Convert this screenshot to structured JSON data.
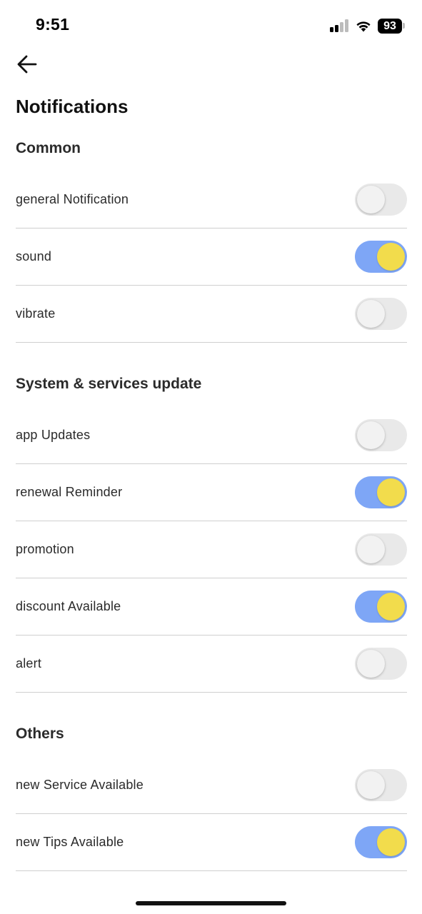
{
  "status_bar": {
    "time": "9:51",
    "battery_level": "93",
    "icons": [
      "signal-icon",
      "wifi-icon",
      "battery-icon"
    ]
  },
  "header": {
    "back_icon": "arrow-left-icon",
    "title": "Notifications"
  },
  "colors": {
    "toggle_on_track": "#7ea6f6",
    "toggle_on_knob": "#f2dc4c",
    "toggle_off_track": "#e9e9e9",
    "toggle_off_knob": "#f2f2f2",
    "divider": "#cfcfcf"
  },
  "sections": [
    {
      "title": "Common",
      "items": [
        {
          "label": "general Notification",
          "enabled": false
        },
        {
          "label": "sound",
          "enabled": true
        },
        {
          "label": "vibrate",
          "enabled": false
        }
      ]
    },
    {
      "title": "System & services update",
      "items": [
        {
          "label": "app Updates",
          "enabled": false
        },
        {
          "label": "renewal Reminder",
          "enabled": true
        },
        {
          "label": "promotion",
          "enabled": false
        },
        {
          "label": "discount Available",
          "enabled": true
        },
        {
          "label": "alert",
          "enabled": false
        }
      ]
    },
    {
      "title": "Others",
      "items": [
        {
          "label": "new Service Available",
          "enabled": false
        },
        {
          "label": "new Tips Available",
          "enabled": true
        }
      ]
    }
  ]
}
